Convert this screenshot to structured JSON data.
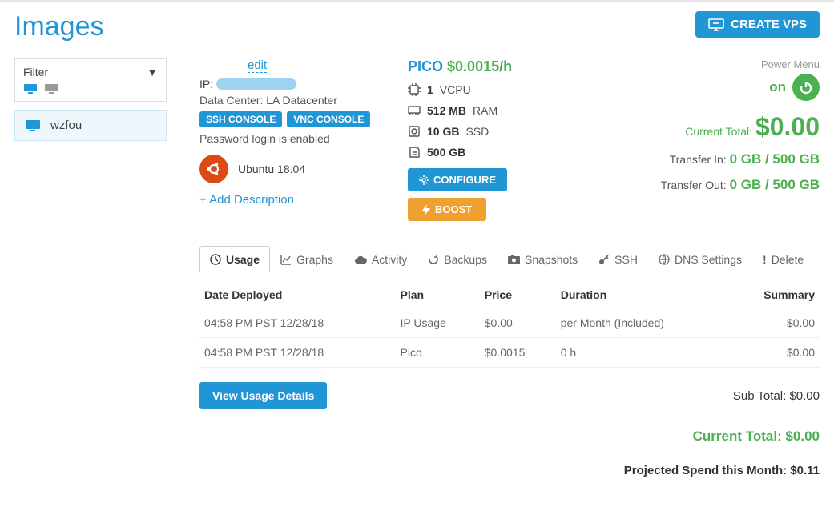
{
  "page_title": "Images",
  "create_btn": "CREATE VPS",
  "sidebar": {
    "filter_label": "Filter",
    "items": [
      {
        "label": "wzfou"
      }
    ]
  },
  "vps": {
    "edit_label": "edit",
    "ip_label": "IP:",
    "datacenter_label": "Data Center: LA Datacenter",
    "ssh_console": "SSH CONSOLE",
    "vnc_console": "VNC CONSOLE",
    "password_line": "Password login is enabled",
    "os_label": "Ubuntu 18.04",
    "add_description": "+ Add Description"
  },
  "plan": {
    "name": "PICO",
    "price": "$0.0015/h",
    "vcpu_num": "1",
    "vcpu_label": "VCPU",
    "ram_val": "512 MB",
    "ram_label": "RAM",
    "disk_val": "10 GB",
    "disk_label": "SSD",
    "bw_val": "500 GB",
    "configure": "CONFIGURE",
    "boost": "BOOST"
  },
  "status": {
    "power_menu": "Power Menu",
    "power_state": "on",
    "current_total_label": "Current Total:",
    "current_total_amt": "$0.00",
    "transfer_in_label": "Transfer In:",
    "transfer_in_val": "0 GB / 500 GB",
    "transfer_out_label": "Transfer Out:",
    "transfer_out_val": "0 GB / 500 GB"
  },
  "tabs": [
    {
      "label": "Usage"
    },
    {
      "label": "Graphs"
    },
    {
      "label": "Activity"
    },
    {
      "label": "Backups"
    },
    {
      "label": "Snapshots"
    },
    {
      "label": "SSH"
    },
    {
      "label": "DNS Settings"
    },
    {
      "label": "Delete"
    }
  ],
  "usage_table": {
    "headers": [
      "Date Deployed",
      "Plan",
      "Price",
      "Duration",
      "Summary"
    ],
    "rows": [
      {
        "date": "04:58 PM PST 12/28/18",
        "plan": "IP Usage",
        "price": "$0.00",
        "duration": "per Month (Included)",
        "summary": "$0.00"
      },
      {
        "date": "04:58 PM PST 12/28/18",
        "plan": "Pico",
        "price": "$0.0015",
        "duration": "0 h",
        "summary": "$0.00"
      }
    ]
  },
  "view_details": "View Usage Details",
  "sub_total_label": "Sub Total: $0.00",
  "current_total_line": "Current Total: $0.00",
  "projected_line": "Projected Spend this Month: $0.11"
}
